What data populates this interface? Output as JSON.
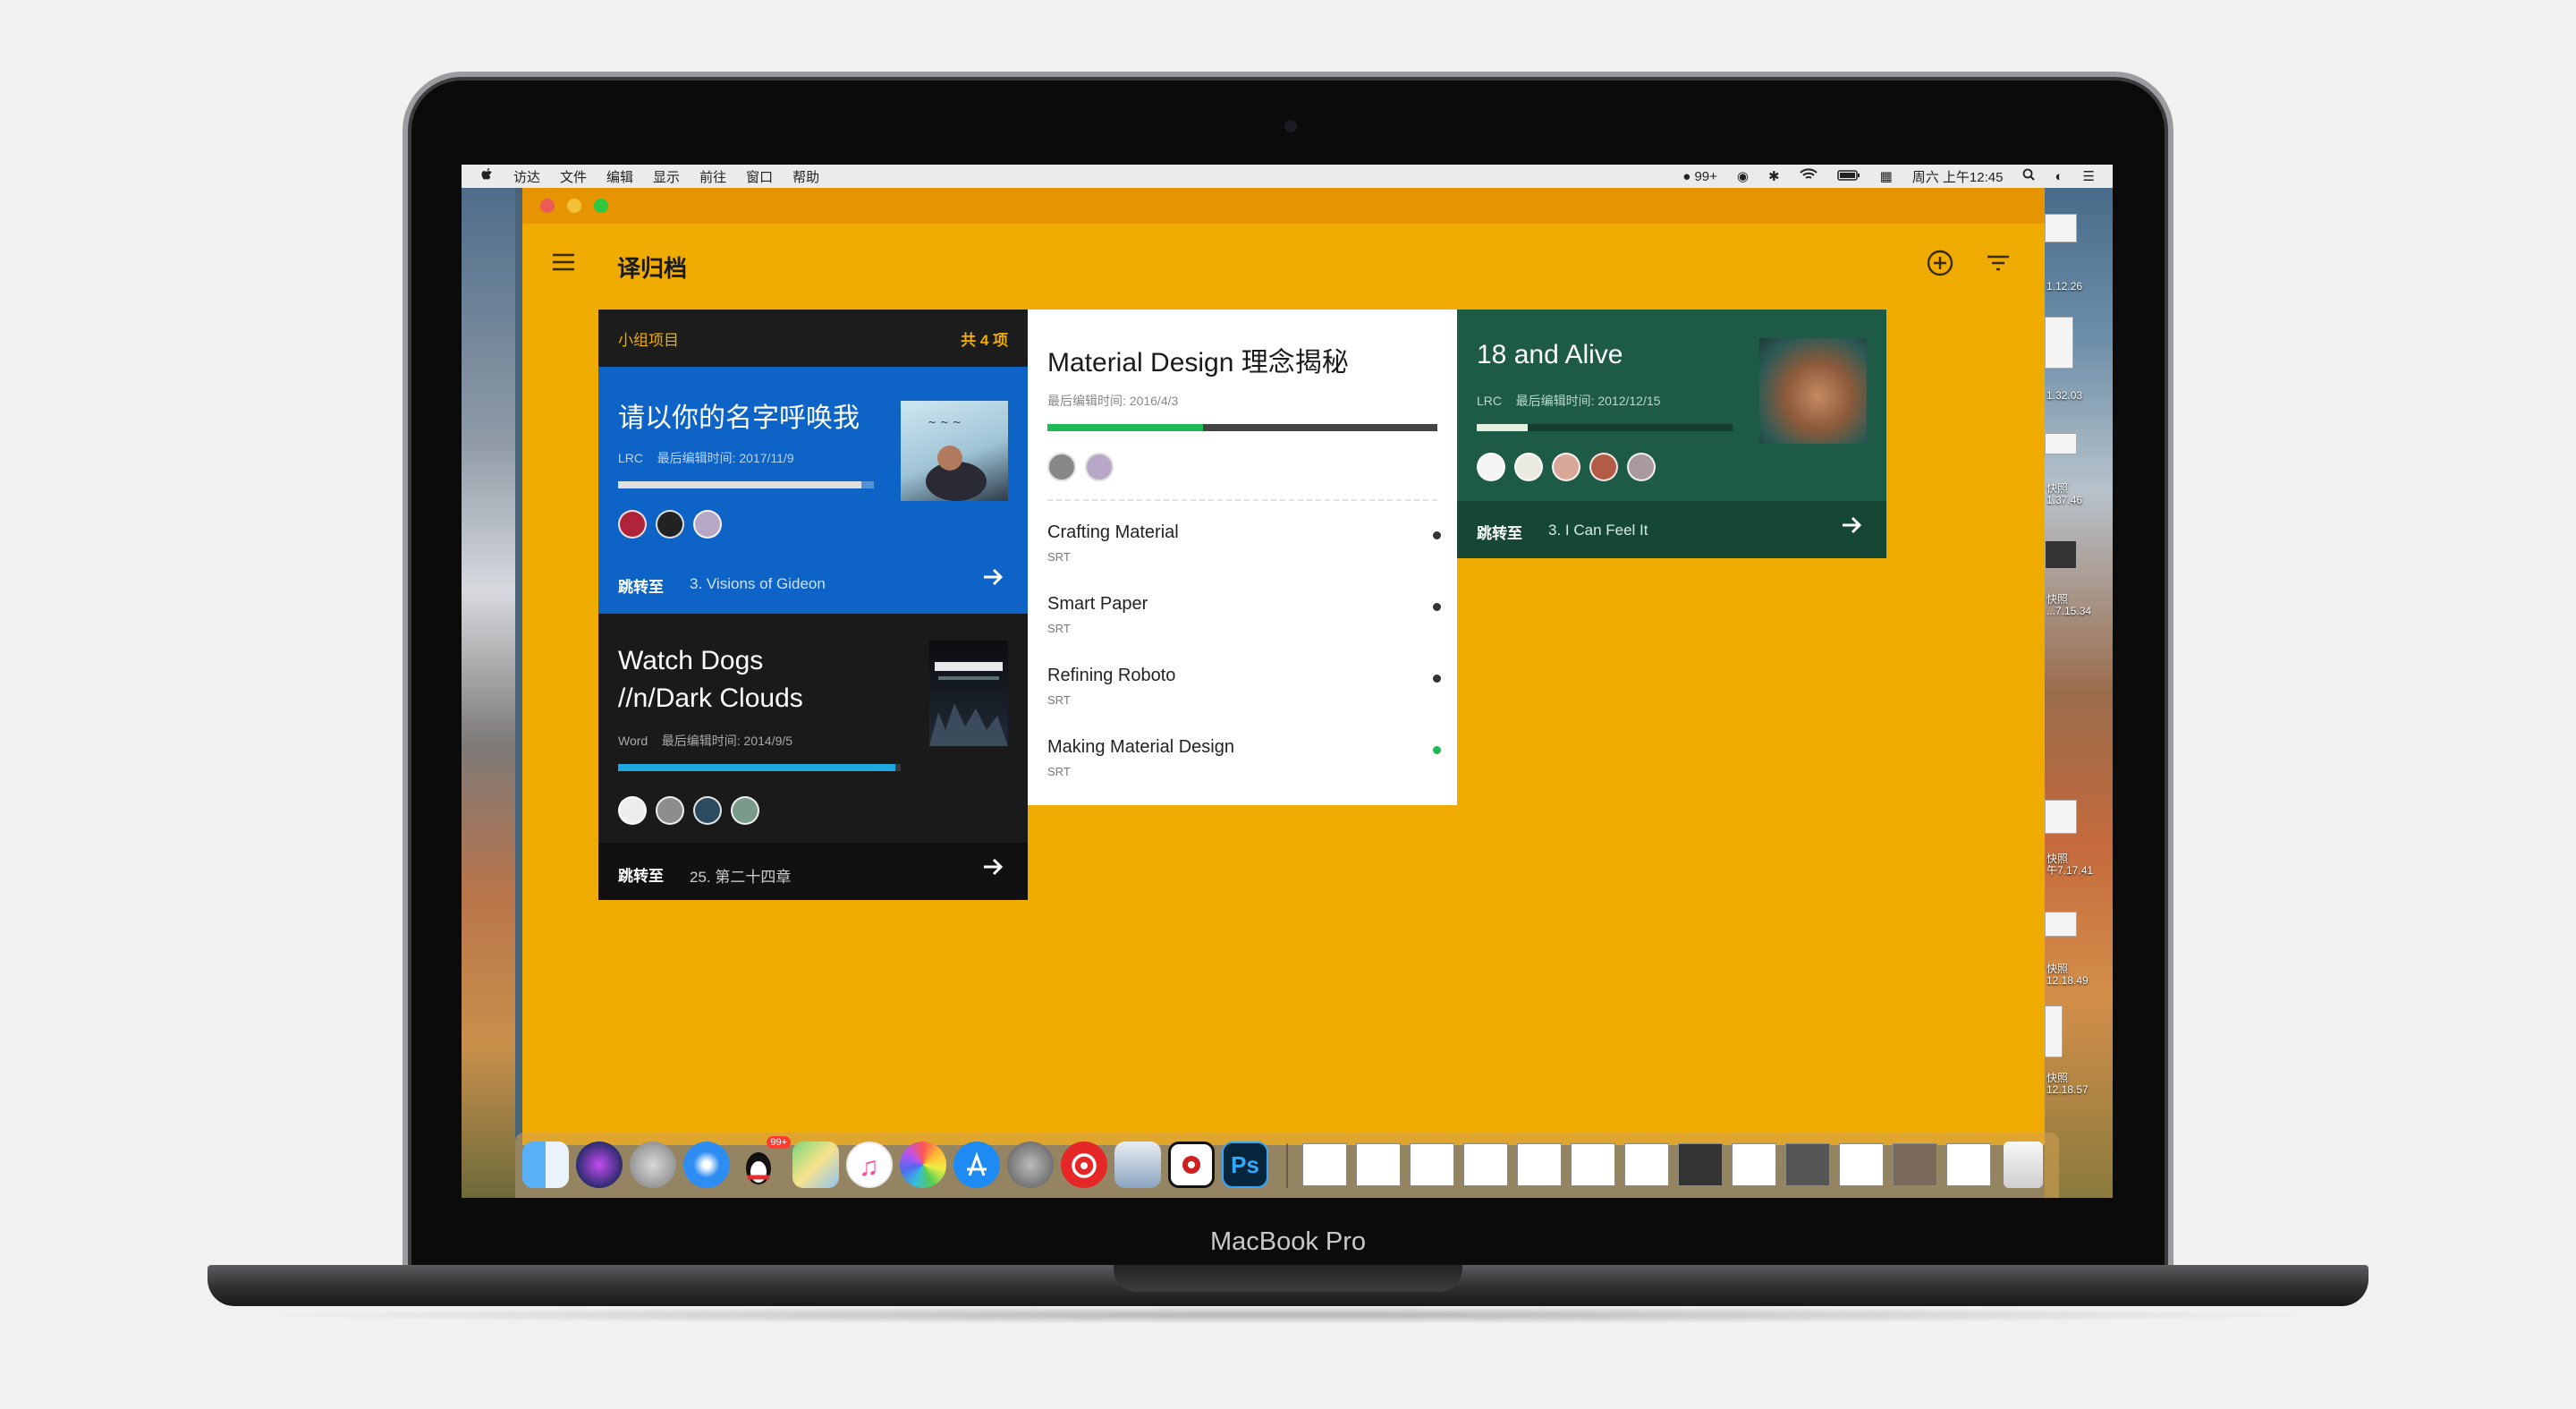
{
  "device": {
    "model_label": "MacBook Pro"
  },
  "menubar": {
    "apple_icon": "apple-icon",
    "items": [
      "访达",
      "文件",
      "编辑",
      "显示",
      "前往",
      "窗口",
      "帮助"
    ],
    "qq_badge": "99+",
    "datetime": "周六 上午12:45"
  },
  "desktop": {
    "screenshots": [
      {
        "label": "1.12.26"
      },
      {
        "label": "1.32.03"
      },
      {
        "label": "快照\n1.37.46"
      },
      {
        "label": "快照\n...7.15.34"
      },
      {
        "label": "快照\n午7.17.41"
      },
      {
        "label": "快照\n12.18.49"
      },
      {
        "label": "快照\n12.18.57"
      }
    ]
  },
  "app": {
    "title": "译归档",
    "group_card": {
      "header_label": "小组项目",
      "header_count": "共 4 项",
      "projects": [
        {
          "title": "请以你的名字呼唤我",
          "type": "LRC",
          "edited": "最后编辑时间: 2017/11/9",
          "progress": 0.95,
          "jump_label": "跳转至",
          "jump_target": "3. Visions of Gideon",
          "color": "#0d63c6"
        },
        {
          "title_line1": "Watch Dogs",
          "title_line2": "//n/Dark Clouds",
          "type": "Word",
          "edited": "最后编辑时间: 2014/9/5",
          "progress": 0.98,
          "jump_label": "跳转至",
          "jump_target": "25. 第二十四章",
          "color": "#1a1a1a"
        }
      ]
    },
    "material_card": {
      "title": "Material Design 理念揭秘",
      "edited": "最后编辑时间: 2016/4/3",
      "progress": 0.4,
      "items": [
        {
          "title": "Crafting Material",
          "type": "SRT",
          "status": "#333333"
        },
        {
          "title": "Smart Paper",
          "type": "SRT",
          "status": "#333333"
        },
        {
          "title": "Refining Roboto",
          "type": "SRT",
          "status": "#333333"
        },
        {
          "title": "Making Material Design",
          "type": "SRT",
          "status": "#1db954"
        }
      ]
    },
    "alive_card": {
      "title": "18 and Alive",
      "type": "LRC",
      "edited": "最后编辑时间: 2012/12/15",
      "progress": 0.2,
      "jump_label": "跳转至",
      "jump_target": "3. I Can Feel It",
      "color": "#1e5b46"
    }
  },
  "dock": {
    "apps": [
      "finder-icon",
      "siri-icon",
      "launchpad-icon",
      "safari-icon",
      "qq-icon",
      "maps-icon",
      "music-icon",
      "photos-icon",
      "app-store-icon",
      "system-preferences-icon",
      "netease-music-icon",
      "preview-icon",
      "screen-capture-icon",
      "photoshop-icon"
    ],
    "qq_badge": "99+",
    "ps_label": "Ps"
  }
}
